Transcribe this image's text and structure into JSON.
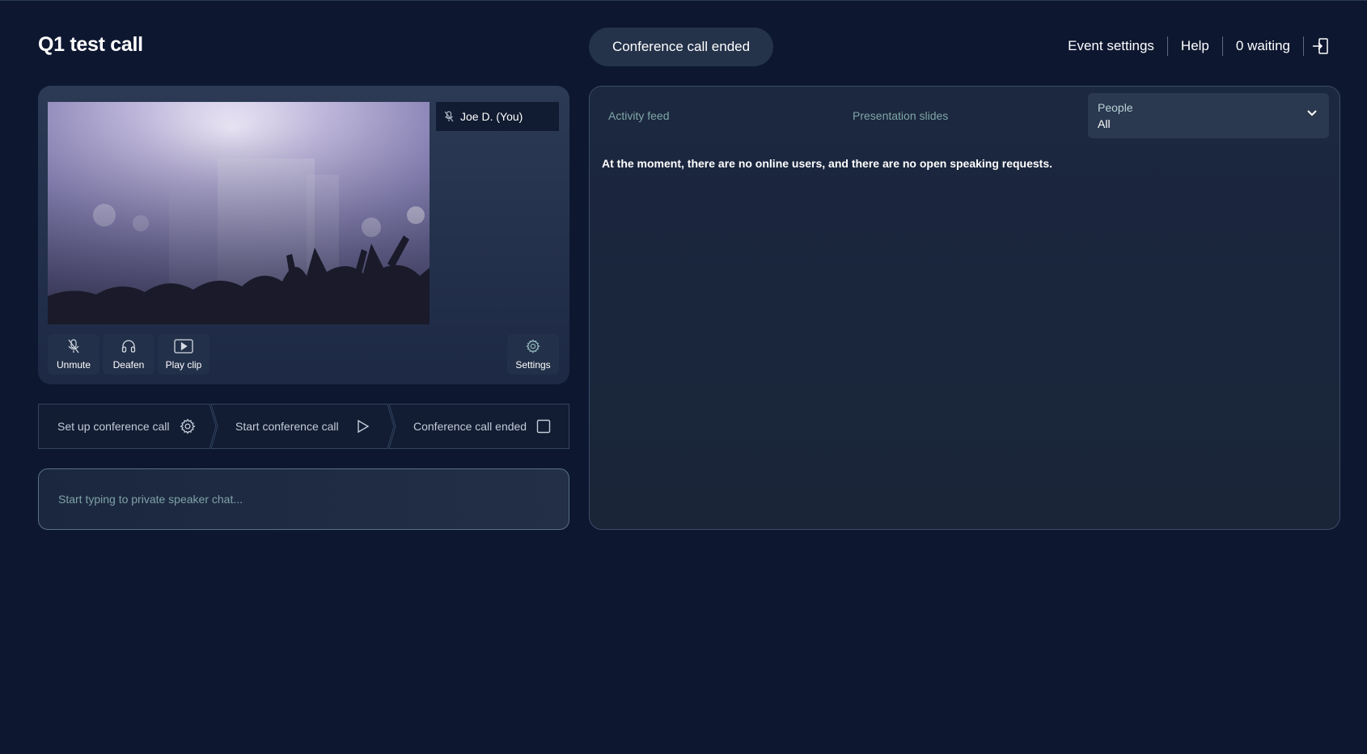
{
  "header": {
    "title": "Q1 test call",
    "status": "Conference call ended",
    "nav": {
      "event_settings": "Event settings",
      "help": "Help",
      "waiting": "0 waiting"
    },
    "exit_icon": "exit-door-icon"
  },
  "video": {
    "participant": "Joe D. (You)",
    "participant_icon": "mic-muted-icon",
    "controls": {
      "unmute": "Unmute",
      "deafen": "Deafen",
      "play_clip": "Play clip",
      "settings": "Settings"
    }
  },
  "stepper": {
    "steps": [
      {
        "label": "Set up conference call",
        "icon": "gear-icon"
      },
      {
        "label": "Start conference call",
        "icon": "play-icon"
      },
      {
        "label": "Conference call ended",
        "icon": "checkbox-icon"
      }
    ]
  },
  "chat": {
    "placeholder": "Start typing to private speaker chat..."
  },
  "panel": {
    "tabs": [
      "Activity feed",
      "Presentation slides"
    ],
    "people_filter": {
      "label": "People",
      "value": "All"
    },
    "message": "At the moment, there are no online users, and there are no open speaking requests."
  },
  "colors": {
    "background": "#0d1730",
    "panel": "#1c283f",
    "accent_text": "#7fa6a8"
  }
}
